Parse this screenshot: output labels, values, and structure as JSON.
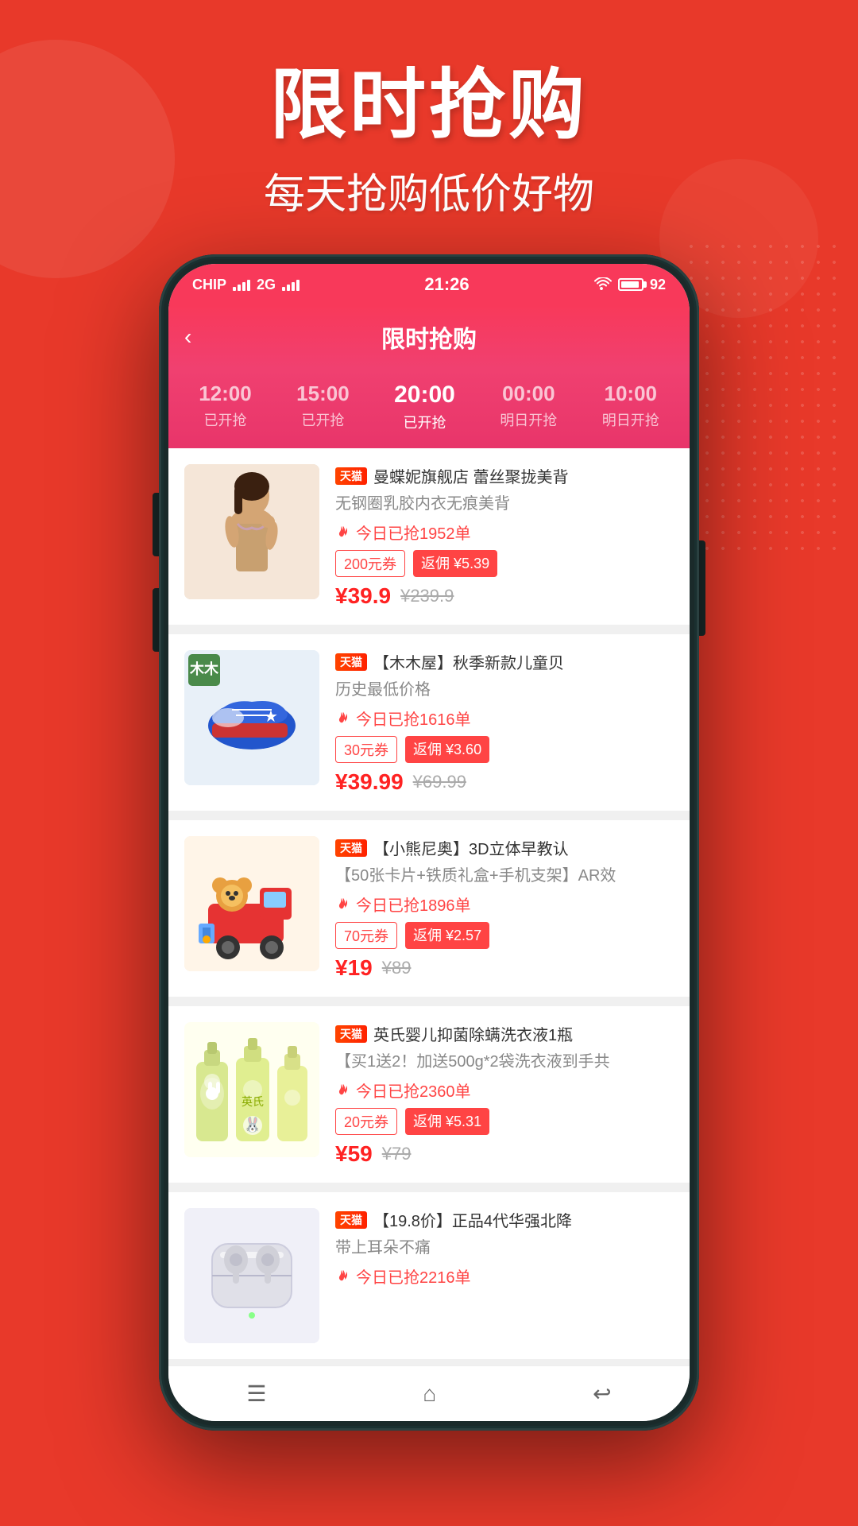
{
  "hero": {
    "title": "限时抢购",
    "subtitle": "每天抢购低价好物"
  },
  "status_bar": {
    "carrier": "CHIP",
    "network": "2G",
    "time": "21:26",
    "battery": "92"
  },
  "app": {
    "title": "限时抢购",
    "back_label": "‹"
  },
  "time_tabs": [
    {
      "time": "12:00",
      "label": "已开抢",
      "active": false
    },
    {
      "time": "15:00",
      "label": "已开抢",
      "active": false
    },
    {
      "time": "20:00",
      "label": "已开抢",
      "active": true
    },
    {
      "time": "00:00",
      "label": "明日开抢",
      "active": false
    },
    {
      "time": "10:00",
      "label": "明日开抢",
      "active": false
    }
  ],
  "products": [
    {
      "store_badge": "天猫",
      "store_name": "曼蝶妮旗舰店",
      "title": "蕾丝聚拢美背",
      "desc": "无钢圈乳胶内衣无痕美背",
      "sold": "今日已抢1952单",
      "coupon": "200元券",
      "rebate": "返佣 ¥5.39",
      "price": "¥39.9",
      "price_original": "¥239.9"
    },
    {
      "store_badge": "天猫",
      "store_name": "【木木屋】",
      "title": "秋季新款儿童贝",
      "desc": "历史最低价格",
      "sold": "今日已抢1616单",
      "coupon": "30元券",
      "rebate": "返佣 ¥3.60",
      "price": "¥39.99",
      "price_original": "¥69.99"
    },
    {
      "store_badge": "天猫",
      "store_name": "【小熊尼奥】",
      "title": "3D立体早教认",
      "desc": "【50张卡片+铁质礼盒+手机支架】AR效",
      "sold": "今日已抢1896单",
      "coupon": "70元券",
      "rebate": "返佣 ¥2.57",
      "price": "¥19",
      "price_original": "¥89"
    },
    {
      "store_badge": "天猫",
      "store_name": "英氏婴儿",
      "title": "抑菌除螨洗衣液1瓶",
      "desc": "【买1送2！加送500g*2袋洗衣液到手共",
      "sold": "今日已抢2360单",
      "coupon": "20元券",
      "rebate": "返佣 ¥5.31",
      "price": "¥59",
      "price_original": "¥79"
    },
    {
      "store_badge": "天猫",
      "store_name": "【19.8价】",
      "title": "正品4代华强北降",
      "desc": "带上耳朵不痛",
      "sold": "今日已抢2216单",
      "coupon": "",
      "rebate": "",
      "price": "",
      "price_original": ""
    }
  ],
  "bottom_nav": {
    "menu_icon": "☰",
    "home_icon": "⌂",
    "back_icon": "↩"
  }
}
